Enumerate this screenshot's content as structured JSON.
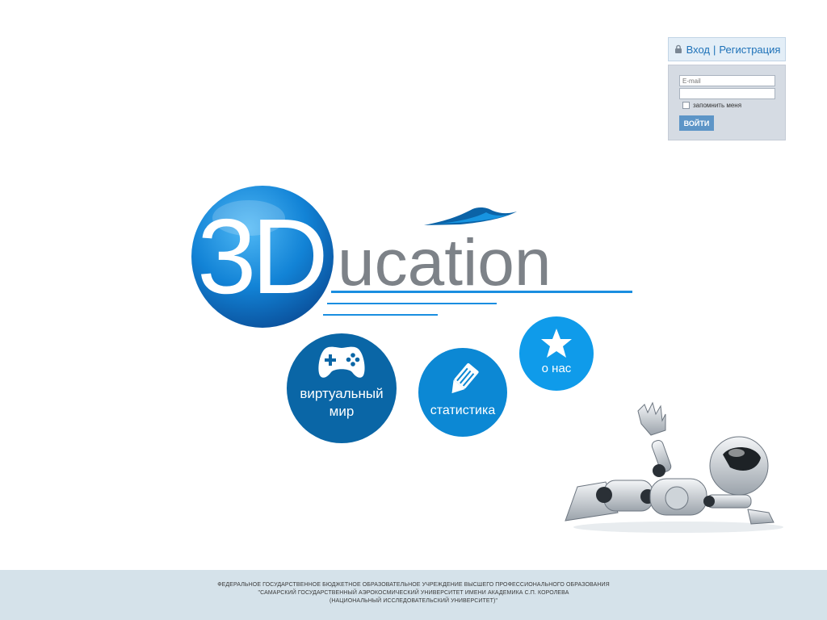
{
  "auth": {
    "login_link": "Вход",
    "separator": "|",
    "register_link": "Регистрация",
    "email_placeholder": "E-mail",
    "password_value": "",
    "remember_label": "запомнить меня",
    "remember_checked": false,
    "submit_label": "ВОЙТИ"
  },
  "logo": {
    "prefix": "3D",
    "suffix": "ucation"
  },
  "nav": {
    "virtual_world": "виртуальный\nмир",
    "statistics": "статистика",
    "about": "о нас"
  },
  "footer": {
    "line1": "ФЕДЕРАЛЬНОЕ ГОСУДАРСТВЕННОЕ БЮДЖЕТНОЕ ОБРАЗОВАТЕЛЬНОЕ УЧРЕЖДЕНИЕ ВЫСШЕГО ПРОФЕССИОНАЛЬНОГО ОБРАЗОВАНИЯ",
    "line2": "\"САМАРСКИЙ ГОСУДАРСТВЕННЫЙ АЭРОКОСМИЧЕСКИЙ УНИВЕРСИТЕТ ИМЕНИ АКАДЕМИКА С.П. КОРОЛЕВА",
    "line3": "(НАЦИОНАЛЬНЫЙ ИССЛЕДОВАТЕЛЬСКИЙ УНИВЕРСИТЕТ)\""
  },
  "colors": {
    "brand_blue": "#0a66a6",
    "accent_blue": "#0f9bea",
    "logo_gray": "#7d8288",
    "footer_bg": "#d5e2ea"
  },
  "icons": {
    "lock": "lock-icon",
    "gamepad": "gamepad-icon",
    "pencil": "pencil-icon",
    "star": "star-icon",
    "robot": "robot-illustration"
  }
}
